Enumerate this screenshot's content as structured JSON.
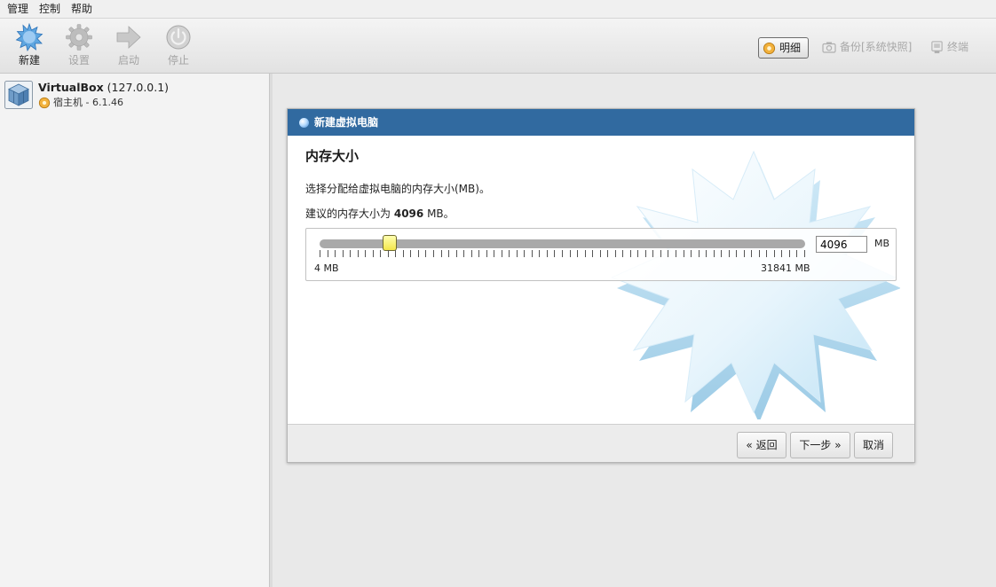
{
  "menu": {
    "items": [
      "管理",
      "控制",
      "帮助"
    ]
  },
  "toolbar": {
    "new_label": "新建",
    "settings_label": "设置",
    "start_label": "启动",
    "stop_label": "停止",
    "details_label": "明细",
    "snapshots_label": "备份[系统快照]",
    "logs_label": "终端"
  },
  "vm_list": {
    "name": "VirtualBox",
    "address": "(127.0.0.1)",
    "host_info": "宿主机 - 6.1.46"
  },
  "dialog": {
    "title": "新建虚拟电脑",
    "heading": "内存大小",
    "description": "选择分配给虚拟电脑的内存大小(MB)。",
    "recommend_prefix": "建议的内存大小为",
    "recommend_value": "4096",
    "recommend_suffix": "MB。",
    "slider": {
      "min_label": "4 MB",
      "max_label": "31841 MB",
      "min": 4,
      "max": 31841,
      "value": 4096
    },
    "memory_value": "4096",
    "unit": "MB",
    "back_button": "« 返回",
    "next_button": "下一步 »",
    "cancel_button": "取消"
  },
  "colors": {
    "title_bar": "#316aa0",
    "slider_thumb": "#f3e64a",
    "slider_track": "#a9a9a9",
    "starburst": "#bfe2f5"
  }
}
